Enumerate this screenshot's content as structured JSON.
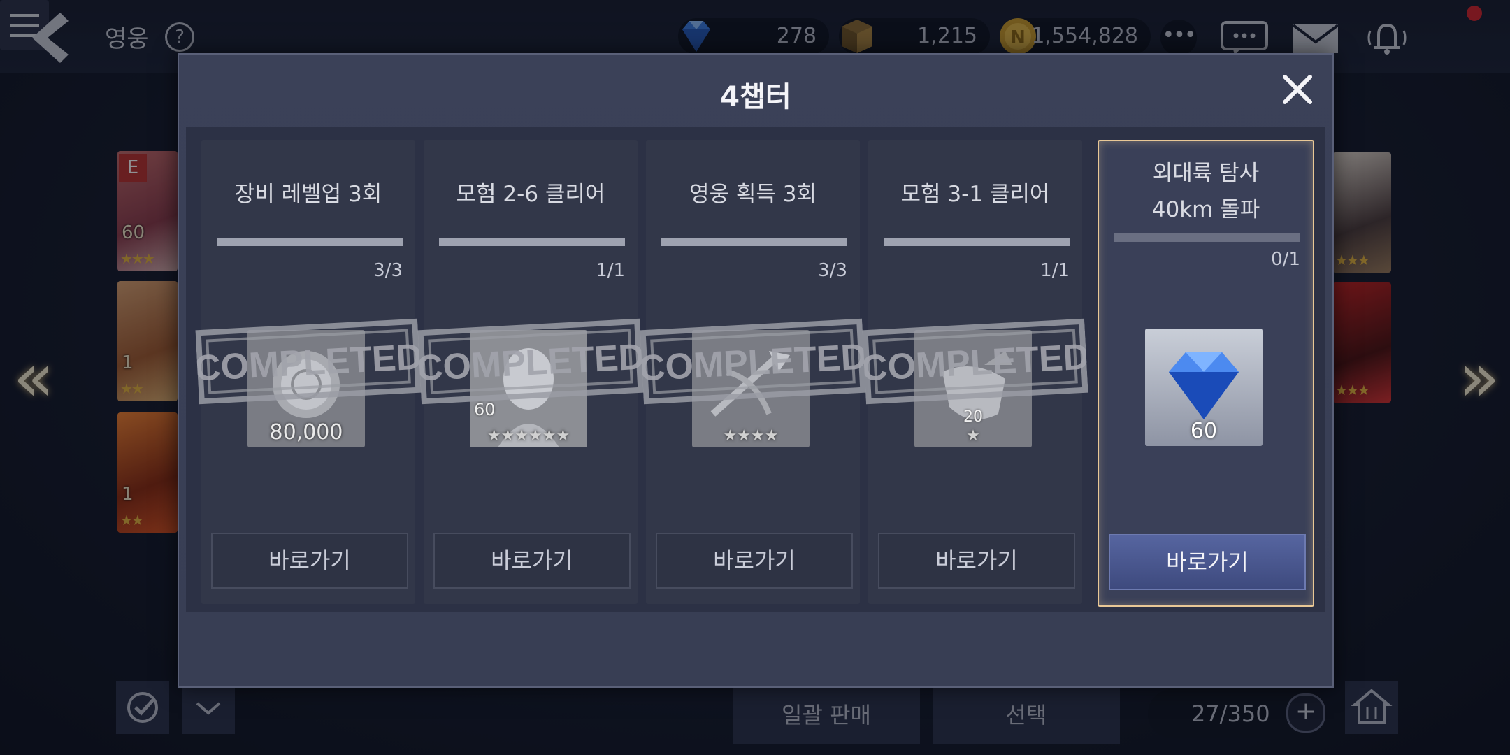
{
  "header": {
    "title": "영웅",
    "help_symbol": "?",
    "currencies": [
      {
        "name": "gem-icon",
        "value": "278"
      },
      {
        "name": "cube-icon",
        "value": "1,215"
      },
      {
        "name": "gold-coin-icon",
        "value": "1,554,828"
      }
    ],
    "more_symbol": "•••"
  },
  "hero_list": {
    "left": [
      {
        "badge": "E",
        "level": "60",
        "stars": "★★★"
      },
      {
        "level": "1",
        "stars": "★★"
      },
      {
        "level": "1",
        "stars": "★★"
      }
    ],
    "right": [
      {
        "stars": "★★★"
      },
      {
        "stars": "★★★"
      }
    ]
  },
  "modal": {
    "title": "4챕터",
    "missions": [
      {
        "title": "장비 레벨업 3회",
        "progress": "3/3",
        "progress_fraction": 1.0,
        "reward_amount": "80,000",
        "reward_icon": "silver-coin-icon",
        "stamp": "COMPLETED",
        "button": "바로가기"
      },
      {
        "title": "모험 2-6 클리어",
        "progress": "1/1",
        "progress_fraction": 1.0,
        "reward_level": "60",
        "reward_stars": "★★★★★★",
        "reward_icon": "hero-portrait-icon",
        "stamp": "COMPLETED",
        "button": "바로가기"
      },
      {
        "title": "영웅 획득 3회",
        "progress": "3/3",
        "progress_fraction": 1.0,
        "reward_stars": "★★★★",
        "reward_icon": "crossbow-icon",
        "stamp": "COMPLETED",
        "button": "바로가기"
      },
      {
        "title": "모험 3-1 클리어",
        "progress": "1/1",
        "progress_fraction": 1.0,
        "reward_level": "20",
        "reward_stars": "★",
        "reward_icon": "gauntlet-icon",
        "stamp": "COMPLETED",
        "button": "바로가기"
      },
      {
        "title_line1": "외대륙 탐사",
        "title_line2": "40km 돌파",
        "progress": "0/1",
        "progress_fraction": 0.0,
        "reward_amount": "60",
        "reward_icon": "blue-gem-icon",
        "button": "바로가기"
      }
    ]
  },
  "footer": {
    "bulk_sell": "일괄 판매",
    "select": "선택",
    "slot_count": "27/350",
    "plus_symbol": "+"
  },
  "colors": {
    "accent_gold_border": "#e9c896",
    "active_button": "#4a578e",
    "notification": "#d4242c"
  }
}
